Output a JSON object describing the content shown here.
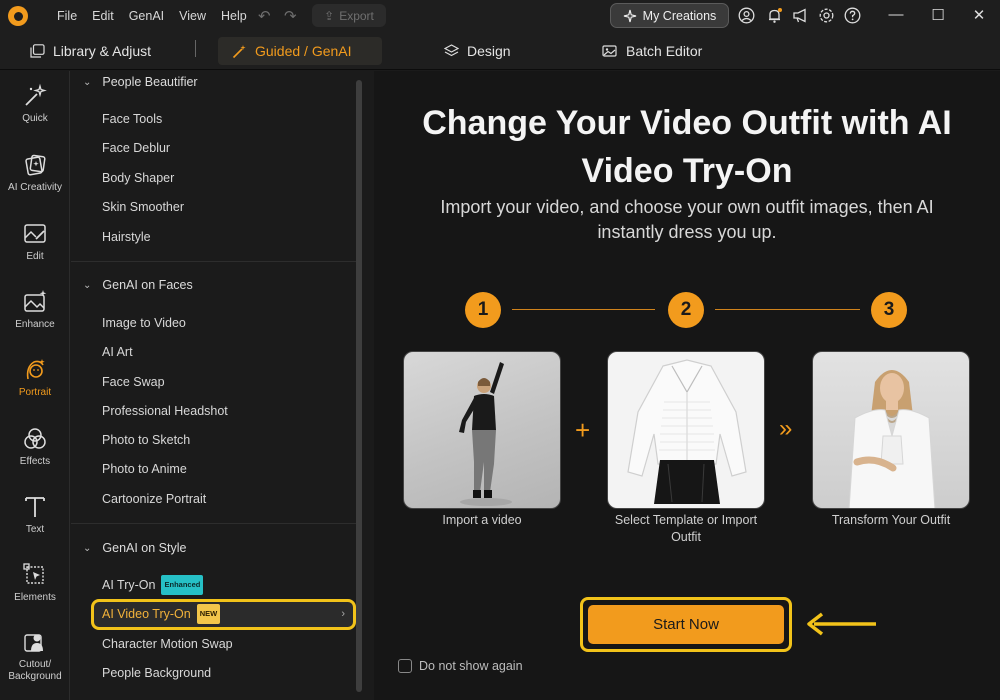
{
  "menu": [
    "File",
    "Edit",
    "GenAI",
    "View",
    "Help"
  ],
  "toolbar": {
    "export_label": "Export",
    "my_creations_label": "My Creations"
  },
  "modes": {
    "library": "Library & Adjust",
    "guided": "Guided / GenAI",
    "design": "Design",
    "batch": "Batch Editor"
  },
  "rail": {
    "quick": "Quick",
    "ai_creativity": "AI Creativity",
    "edit": "Edit",
    "enhance": "Enhance",
    "portrait": "Portrait",
    "effects": "Effects",
    "text": "Text",
    "elements": "Elements",
    "cutout_1": "Cutout/",
    "cutout_2": "Background"
  },
  "panel": {
    "s1": {
      "title": "People Beautifier",
      "items": [
        "Face Tools",
        "Face Deblur",
        "Body Shaper",
        "Skin Smoother",
        "Hairstyle"
      ]
    },
    "s2": {
      "title": "GenAI on Faces",
      "items": [
        "Image to Video",
        "AI Art",
        "Face Swap",
        "Professional Headshot",
        "Photo to Sketch",
        "Photo to Anime",
        "Cartoonize Portrait"
      ]
    },
    "s3": {
      "title": "GenAI on Style",
      "items": [
        "AI Try-On",
        "AI Video Try-On",
        "Character Motion Swap",
        "People Background"
      ],
      "badge_enhanced": "Enhanced",
      "badge_new": "NEW"
    }
  },
  "main": {
    "headline_1": "Change Your Video Outfit with AI",
    "headline_2": "Video Try-On",
    "subline_1": "Import your video, and choose your own outfit images, then AI",
    "subline_2": "instantly dress you up.",
    "steps": [
      "1",
      "2",
      "3"
    ],
    "cards": {
      "c1_label": "Import a video",
      "c2_label_1": "Select Template or Import",
      "c2_label_2": "Outfit",
      "c3_label": "Transform Your Outfit"
    },
    "plus": "+",
    "chev": "»",
    "start_label": "Start Now",
    "dont_show": "Do not show again"
  },
  "colors": {
    "accent": "#f29b1d",
    "highlight": "#f2c31a",
    "bg": "#161616"
  }
}
